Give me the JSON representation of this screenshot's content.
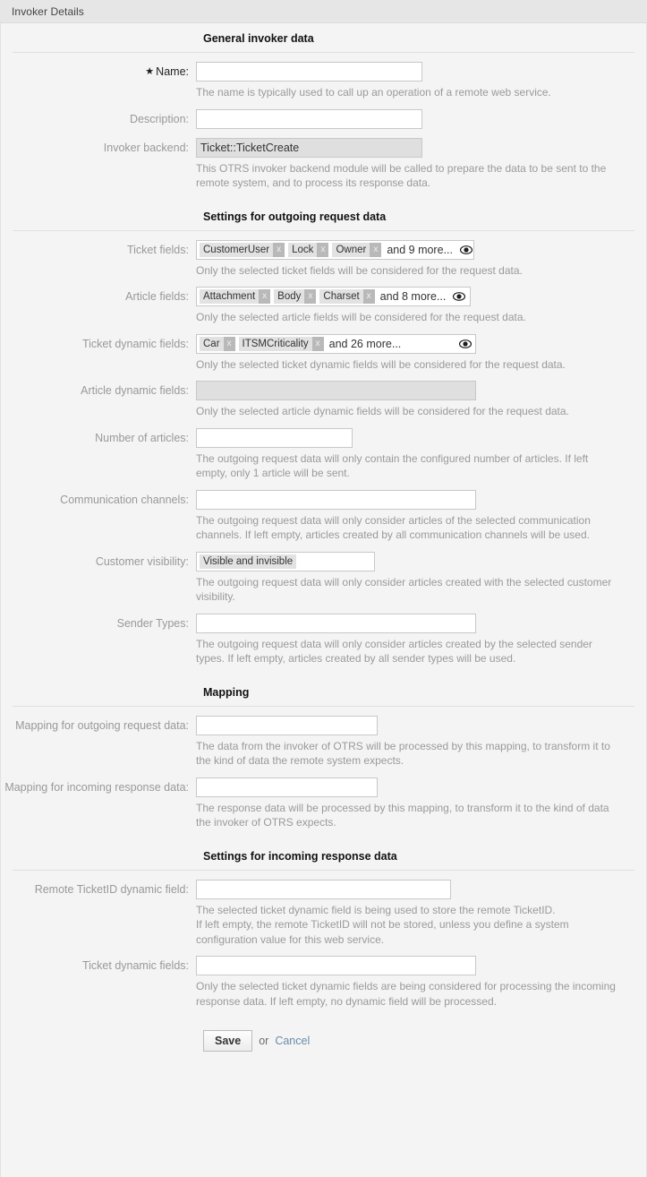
{
  "window": {
    "title": "Invoker Details"
  },
  "sections": {
    "general": {
      "title": "General invoker data"
    },
    "outgoing": {
      "title": "Settings for outgoing request data"
    },
    "mapping": {
      "title": "Mapping"
    },
    "incoming": {
      "title": "Settings for incoming response data"
    }
  },
  "fields": {
    "name": {
      "label": "Name:",
      "required_marker": "★",
      "value": "",
      "hint": "The name is typically used to call up an operation of a remote web service."
    },
    "description": {
      "label": "Description:",
      "value": ""
    },
    "invoker_backend": {
      "label": "Invoker backend:",
      "value": "Ticket::TicketCreate",
      "hint": "This OTRS invoker backend module will be called to prepare the data to be sent to the remote system, and to process its response data."
    },
    "ticket_fields": {
      "label": "Ticket fields:",
      "chips": [
        {
          "label": "CustomerUser",
          "remove": "x"
        },
        {
          "label": "Lock",
          "remove": "x"
        },
        {
          "label": "Owner",
          "remove": "x"
        }
      ],
      "more": "and 9 more...",
      "eye_icon": "eye-icon",
      "hint": "Only the selected ticket fields will be considered for the request data."
    },
    "article_fields": {
      "label": "Article fields:",
      "chips": [
        {
          "label": "Attachment",
          "remove": "x"
        },
        {
          "label": "Body",
          "remove": "x"
        },
        {
          "label": "Charset",
          "remove": "x"
        }
      ],
      "more": "and 8 more...",
      "eye_icon": "eye-icon",
      "hint": "Only the selected article fields will be considered for the request data."
    },
    "ticket_dynamic_fields": {
      "label": "Ticket dynamic fields:",
      "chips": [
        {
          "label": "Car",
          "remove": "x"
        },
        {
          "label": "ITSMCriticality",
          "remove": "x"
        }
      ],
      "more": "and 26 more...",
      "eye_icon": "eye-icon",
      "hint": "Only the selected ticket dynamic fields will be considered for the request data."
    },
    "article_dynamic_fields": {
      "label": "Article dynamic fields:",
      "value": "",
      "hint": "Only the selected article dynamic fields will be considered for the request data."
    },
    "number_of_articles": {
      "label": "Number of articles:",
      "value": "",
      "hint": "The outgoing request data will only contain the configured number of articles. If left empty, only 1 article will be sent."
    },
    "communication_channels": {
      "label": "Communication channels:",
      "value": "",
      "hint": "The outgoing request data will only consider articles of the selected communication channels. If left empty, articles created by all communication channels will be used."
    },
    "customer_visibility": {
      "label": "Customer visibility:",
      "selected": "Visible and invisible",
      "hint": "The outgoing request data will only consider articles created with the selected customer visibility."
    },
    "sender_types": {
      "label": "Sender Types:",
      "value": "",
      "hint": "The outgoing request data will only consider articles created by the selected sender types. If left empty, articles created by all sender types will be used."
    },
    "mapping_outgoing": {
      "label": "Mapping for outgoing request data:",
      "value": "",
      "hint": "The data from the invoker of OTRS will be processed by this mapping, to transform it to the kind of data the remote system expects."
    },
    "mapping_incoming": {
      "label": "Mapping for incoming response data:",
      "value": "",
      "hint": "The response data will be processed by this mapping, to transform it to the kind of data the invoker of OTRS expects."
    },
    "remote_ticketid_dynamic_field": {
      "label": "Remote TicketID dynamic field:",
      "value": "",
      "hint": "The selected ticket dynamic field is being used to store the remote TicketID.\nIf left empty, the remote TicketID will not be stored, unless you define a system configuration value for this web service."
    },
    "response_ticket_dynamic_fields": {
      "label": "Ticket dynamic fields:",
      "value": "",
      "hint": "Only the selected ticket dynamic fields are being considered for processing the incoming response data. If left empty, no dynamic field will be processed."
    }
  },
  "footer": {
    "save_label": "Save",
    "or_label": "or",
    "cancel_label": "Cancel"
  },
  "colors": {
    "page_bg": "#f4f4f4",
    "header_bg": "#e6e6e6",
    "label": "#999999",
    "hint": "#9a9a9a",
    "chip_bg": "#e2e2e2",
    "chip_x_bg": "#b9b9b9",
    "link": "#6a8bab"
  }
}
